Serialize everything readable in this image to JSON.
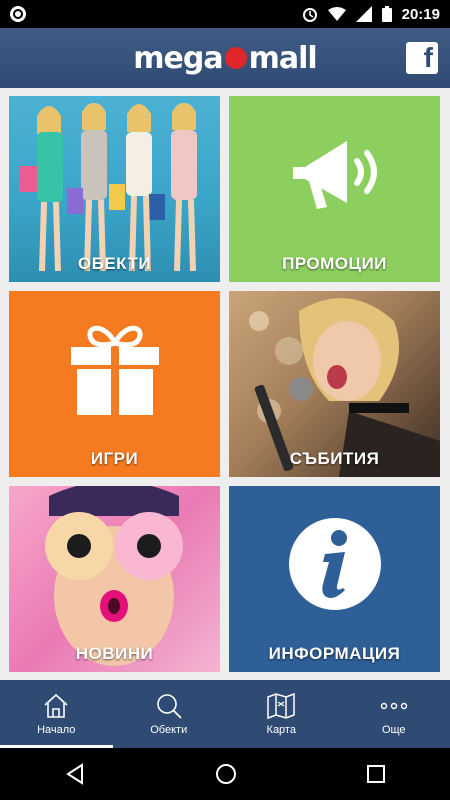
{
  "status_bar": {
    "time": "20:19"
  },
  "app_bar": {
    "logo_left": "mega",
    "logo_right": "mall",
    "facebook_label": "f"
  },
  "tiles": [
    {
      "label": "ОБЕКТИ"
    },
    {
      "label": "ПРОМОЦИИ"
    },
    {
      "label": "ИГРИ"
    },
    {
      "label": "СЪБИТИЯ"
    },
    {
      "label": "НОВИНИ"
    },
    {
      "label": "ИНФОРМАЦИЯ"
    }
  ],
  "bottom_nav": [
    {
      "label": "Начало",
      "icon": "home-icon",
      "active": true
    },
    {
      "label": "Обекти",
      "icon": "search-icon",
      "active": false
    },
    {
      "label": "Карта",
      "icon": "map-icon",
      "active": false
    },
    {
      "label": "Още",
      "icon": "more-icon",
      "active": false
    }
  ],
  "colors": {
    "app_bar": "#2f4b73",
    "promo": "#8dcf5f",
    "games": "#f57a20",
    "info": "#2f5f97",
    "logo_dot": "#e0262b"
  }
}
